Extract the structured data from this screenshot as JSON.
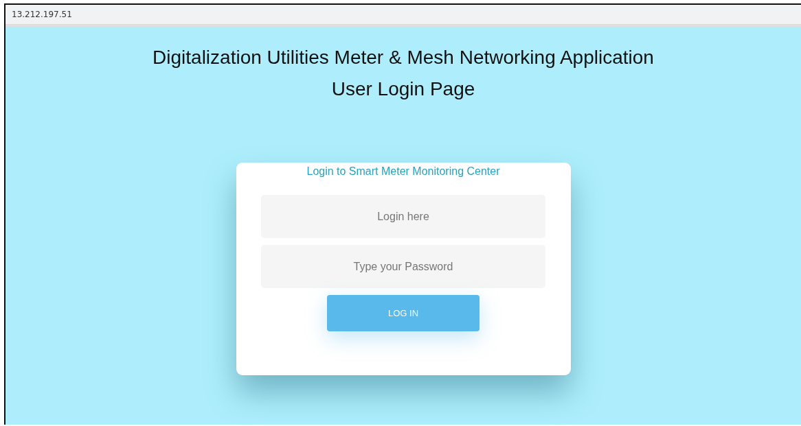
{
  "address_bar": {
    "url": "13.212.197.51"
  },
  "heading": {
    "lines": [
      "Digitalization Utilities Meter & Mesh Networking Application",
      "User Login Page"
    ]
  },
  "login_card": {
    "title": "Login to Smart Meter Monitoring Center",
    "fields": [
      {
        "placeholder": "Login here"
      },
      {
        "placeholder": "Type your Password"
      }
    ],
    "button": "LOG IN"
  }
}
